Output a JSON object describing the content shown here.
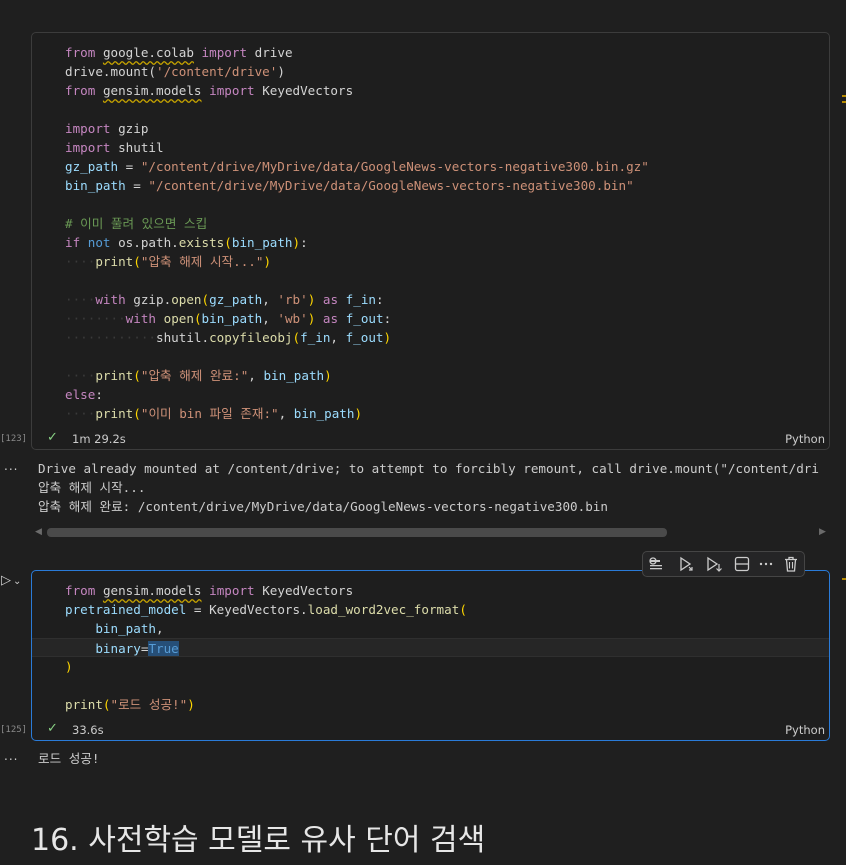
{
  "cell1": {
    "lines": [
      [
        [
          "kc",
          "from"
        ],
        [
          "t",
          " "
        ],
        [
          "t u",
          "google.colab"
        ],
        [
          "t",
          " "
        ],
        [
          "kc",
          "import"
        ],
        [
          "t",
          " drive"
        ]
      ],
      [
        [
          "t",
          "drive.mount("
        ],
        [
          "s",
          "'/content/drive'"
        ],
        [
          "t",
          ")"
        ]
      ],
      [
        [
          "kc",
          "from"
        ],
        [
          "t",
          " "
        ],
        [
          "t u",
          "gensim.models"
        ],
        [
          "t",
          " "
        ],
        [
          "kc",
          "import"
        ],
        [
          "t",
          " KeyedVectors"
        ]
      ],
      [],
      [
        [
          "kc",
          "import"
        ],
        [
          "t",
          " gzip"
        ]
      ],
      [
        [
          "kc",
          "import"
        ],
        [
          "t",
          " shutil"
        ]
      ],
      [
        [
          "v",
          "gz_path"
        ],
        [
          "t",
          " = "
        ],
        [
          "s",
          "\"/content/drive/MyDrive/data/GoogleNews-vectors-negative300.bin.gz\""
        ]
      ],
      [
        [
          "v",
          "bin_path"
        ],
        [
          "t",
          " = "
        ],
        [
          "s",
          "\"/content/drive/MyDrive/data/GoogleNews-vectors-negative300.bin\""
        ]
      ],
      [],
      [
        [
          "c",
          "# 이미 풀려 있으면 스킵"
        ]
      ],
      [
        [
          "kc",
          "if"
        ],
        [
          "t",
          " "
        ],
        [
          "k",
          "not"
        ],
        [
          "t",
          " os.path."
        ],
        [
          "f",
          "exists"
        ],
        [
          "p1",
          "("
        ],
        [
          "v",
          "bin_path"
        ],
        [
          "p1",
          ")"
        ],
        [
          "t",
          ":"
        ]
      ],
      [
        [
          "ws",
          "····"
        ],
        [
          "f",
          "print"
        ],
        [
          "p1",
          "("
        ],
        [
          "s",
          "\"압축 해제 시작...\""
        ],
        [
          "p1",
          ")"
        ]
      ],
      [],
      [
        [
          "ws",
          "····"
        ],
        [
          "kc",
          "with"
        ],
        [
          "t",
          " gzip."
        ],
        [
          "f",
          "open"
        ],
        [
          "p1",
          "("
        ],
        [
          "v",
          "gz_path"
        ],
        [
          "t",
          ", "
        ],
        [
          "s",
          "'rb'"
        ],
        [
          "p1",
          ")"
        ],
        [
          "t",
          " "
        ],
        [
          "kc",
          "as"
        ],
        [
          "t",
          " "
        ],
        [
          "v",
          "f_in"
        ],
        [
          "t",
          ":"
        ]
      ],
      [
        [
          "ws",
          "········"
        ],
        [
          "kc",
          "with"
        ],
        [
          "t",
          " "
        ],
        [
          "f",
          "open"
        ],
        [
          "p1",
          "("
        ],
        [
          "v",
          "bin_path"
        ],
        [
          "t",
          ", "
        ],
        [
          "s",
          "'wb'"
        ],
        [
          "p1",
          ")"
        ],
        [
          "t",
          " "
        ],
        [
          "kc",
          "as"
        ],
        [
          "t",
          " "
        ],
        [
          "v",
          "f_out"
        ],
        [
          "t",
          ":"
        ]
      ],
      [
        [
          "ws",
          "············"
        ],
        [
          "t",
          "shutil."
        ],
        [
          "f",
          "copyfileobj"
        ],
        [
          "p1",
          "("
        ],
        [
          "v",
          "f_in"
        ],
        [
          "t",
          ", "
        ],
        [
          "v",
          "f_out"
        ],
        [
          "p1",
          ")"
        ]
      ],
      [],
      [
        [
          "ws",
          "····"
        ],
        [
          "f",
          "print"
        ],
        [
          "p1",
          "("
        ],
        [
          "s",
          "\"압축 해제 완료:\""
        ],
        [
          "t",
          ", "
        ],
        [
          "v",
          "bin_path"
        ],
        [
          "p1",
          ")"
        ]
      ],
      [
        [
          "kc",
          "else"
        ],
        [
          "t",
          ":"
        ]
      ],
      [
        [
          "ws",
          "····"
        ],
        [
          "f",
          "print"
        ],
        [
          "p1",
          "("
        ],
        [
          "s",
          "\"이미 bin 파일 존재:\""
        ],
        [
          "t",
          ", "
        ],
        [
          "v",
          "bin_path"
        ],
        [
          "p1",
          ")"
        ]
      ]
    ],
    "exec_count": "[123]",
    "duration": "1m 29.2s",
    "language": "Python"
  },
  "output1": {
    "more": "...",
    "lines": [
      "Drive already mounted at /content/drive; to attempt to forcibly remount, call drive.mount(\"/content/dri",
      "압축 해제 시작...",
      "압축 해제 완료: /content/drive/MyDrive/data/GoogleNews-vectors-negative300.bin"
    ]
  },
  "cell2": {
    "lines": [
      [
        [
          "kc",
          "from"
        ],
        [
          "t",
          " "
        ],
        [
          "t u",
          "gensim.models"
        ],
        [
          "t",
          " "
        ],
        [
          "kc",
          "import"
        ],
        [
          "t",
          " KeyedVectors"
        ]
      ],
      [
        [
          "v",
          "pretrained_model"
        ],
        [
          "t",
          " = KeyedVectors."
        ],
        [
          "f",
          "load_word2vec_format"
        ],
        [
          "p1",
          "("
        ]
      ],
      [
        [
          "ws",
          "    "
        ],
        [
          "v",
          "bin_path"
        ],
        [
          "t",
          ","
        ]
      ],
      [
        [
          "ws",
          "    "
        ],
        [
          "v",
          "binary"
        ],
        [
          "t",
          "="
        ],
        [
          "k sel",
          "True"
        ]
      ],
      [
        [
          "p1",
          ")"
        ]
      ],
      [],
      [
        [
          "f",
          "print"
        ],
        [
          "p1",
          "("
        ],
        [
          "s",
          "\"로드 성공!\""
        ],
        [
          "p1",
          ")"
        ]
      ]
    ],
    "exec_count": "[125]",
    "duration": "33.6s",
    "language": "Python"
  },
  "output2": {
    "more": "...",
    "lines": [
      "로드 성공!"
    ]
  },
  "heading": "16. 사전학습 모델로 유사 단어 검색",
  "toolbar_icons": [
    "execute-above-icon",
    "execute-cell-below-icon",
    "split-cell-icon",
    "more-icon",
    "delete-icon"
  ],
  "colors": {
    "active_border": "#2a7bd8",
    "keyword": "#c586c0",
    "string": "#ce9178",
    "function": "#dcdcaa",
    "variable": "#9cdcfe",
    "comment": "#6a9955"
  }
}
